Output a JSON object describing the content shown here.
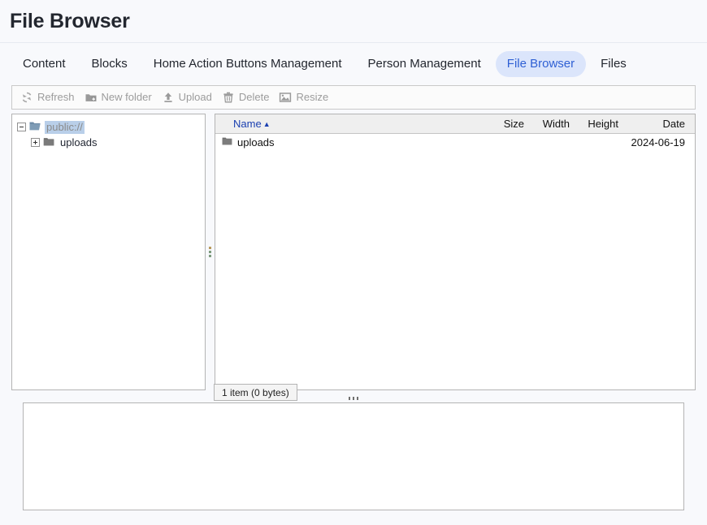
{
  "header": {
    "title": "File Browser"
  },
  "tabs": [
    {
      "label": "Content",
      "active": false
    },
    {
      "label": "Blocks",
      "active": false
    },
    {
      "label": "Home Action Buttons Management",
      "active": false
    },
    {
      "label": "Person Management",
      "active": false
    },
    {
      "label": "File Browser",
      "active": true
    },
    {
      "label": "Files",
      "active": false
    }
  ],
  "toolbar": {
    "buttons": [
      {
        "label": "Refresh",
        "icon": "refresh-icon",
        "disabled": true
      },
      {
        "label": "New folder",
        "icon": "new-folder-icon",
        "disabled": true
      },
      {
        "label": "Upload",
        "icon": "upload-icon",
        "disabled": true
      },
      {
        "label": "Delete",
        "icon": "delete-icon",
        "disabled": true
      },
      {
        "label": "Resize",
        "icon": "resize-image-icon",
        "disabled": true
      }
    ]
  },
  "tree": {
    "root": {
      "label": "public://",
      "selected": true,
      "expanded": true,
      "icon": "folder-open-icon"
    },
    "children": [
      {
        "label": "uploads",
        "selected": false,
        "expanded": false,
        "icon": "folder-icon"
      }
    ]
  },
  "file_list": {
    "columns": [
      {
        "key": "name",
        "label": "Name",
        "sorted": true,
        "sort_dir": "▲"
      },
      {
        "key": "size",
        "label": "Size",
        "sorted": false
      },
      {
        "key": "width",
        "label": "Width",
        "sorted": false
      },
      {
        "key": "height",
        "label": "Height",
        "sorted": false
      },
      {
        "key": "date",
        "label": "Date",
        "sorted": false
      }
    ],
    "rows": [
      {
        "icon": "folder-icon",
        "name": "uploads",
        "size": "",
        "width": "",
        "height": "",
        "date": "2024-06-19"
      }
    ],
    "status": "1 item (0 bytes)"
  },
  "preview": {
    "content": ""
  },
  "colors": {
    "accent": "#2f60d4",
    "active_tab_bg": "#dbe5fb",
    "page_bg": "#f8f9fc",
    "pane_border": "#b4b4b4",
    "header_bg": "#efefef",
    "disabled_text": "#9c9c9c",
    "sort_link": "#1a3fb0",
    "tree_selection": "#b9cfe9"
  }
}
